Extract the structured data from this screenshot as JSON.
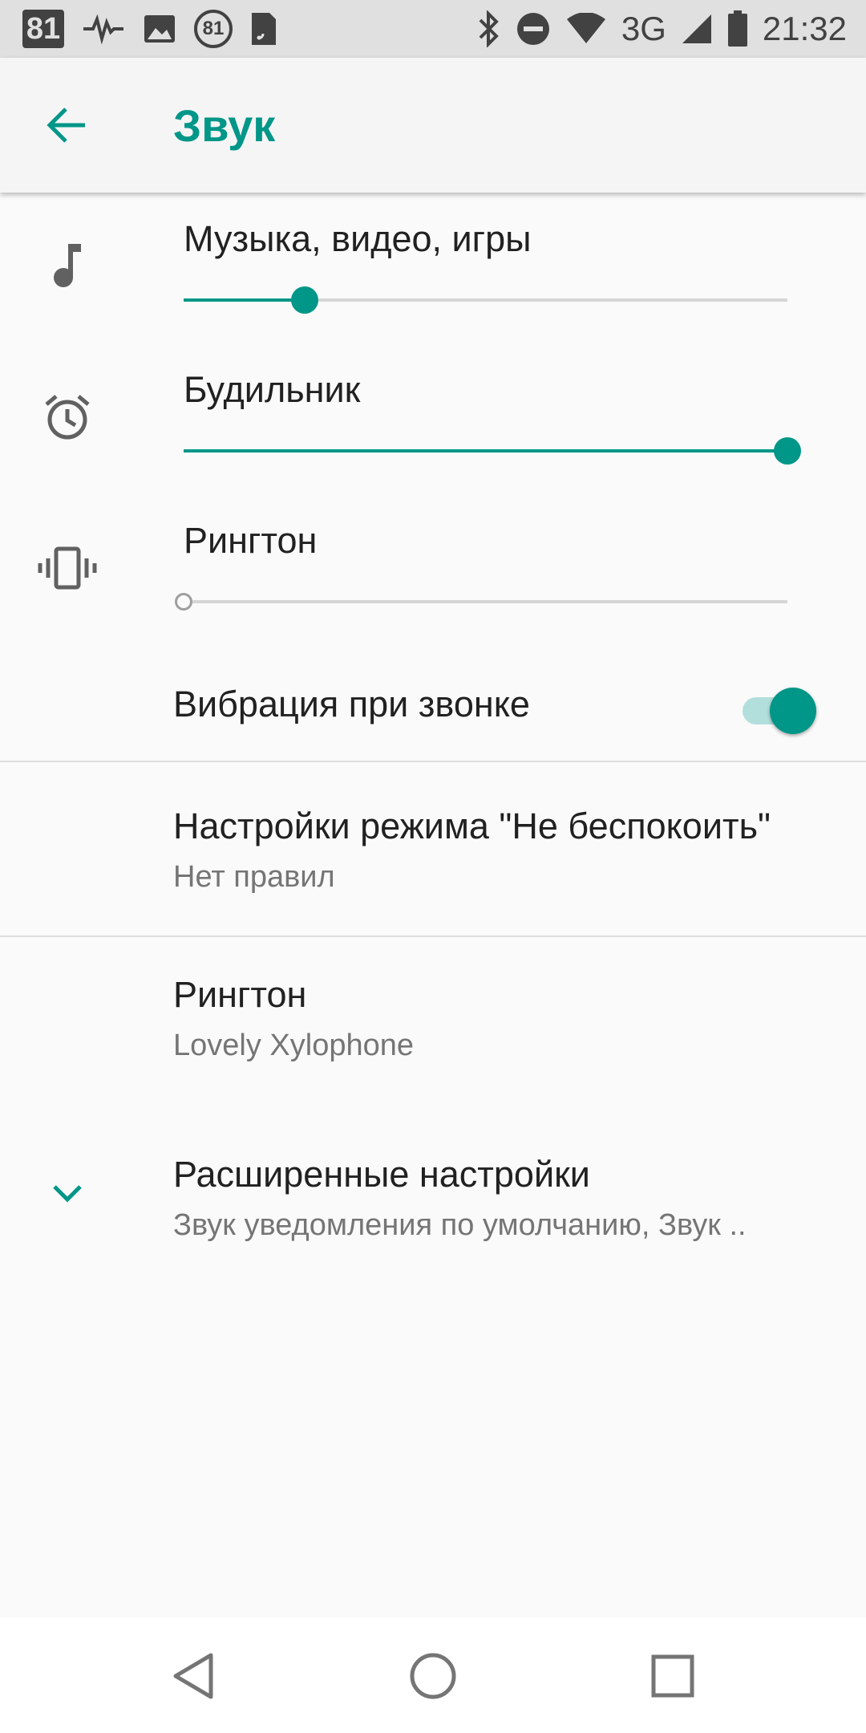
{
  "status_bar": {
    "left_badge": "81",
    "badge_ring": "81",
    "network": "3G",
    "time": "21:32"
  },
  "app_bar": {
    "title": "Звук",
    "back_icon": "arrow-back-icon"
  },
  "volume": {
    "media": {
      "label": "Музыка, видео, игры",
      "level": 0.2,
      "icon": "music-note-icon"
    },
    "alarm": {
      "label": "Будильник",
      "level": 1.0,
      "icon": "alarm-icon"
    },
    "ringtone": {
      "label": "Рингтон",
      "level": 0.0,
      "icon": "vibrate-icon"
    }
  },
  "vibrate_on_ring": {
    "label": "Вибрация при звонке",
    "enabled": true
  },
  "dnd": {
    "title": "Настройки режима \"Не беспокоить\"",
    "summary": "Нет правил"
  },
  "phone_ringtone": {
    "title": "Рингтон",
    "summary": "Lovely Xylophone"
  },
  "advanced": {
    "title": "Расширенные настройки",
    "summary": "Звук уведомления по умолчанию, Звук ..",
    "icon": "chevron-down-icon"
  },
  "nav": {
    "back": "nav-back-icon",
    "home": "nav-home-icon",
    "recents": "nav-recents-icon"
  },
  "colors": {
    "accent": "#009688",
    "accent_light": "#b2dfdb",
    "status_bar": "#e0e0e0",
    "background": "#fafafa"
  }
}
